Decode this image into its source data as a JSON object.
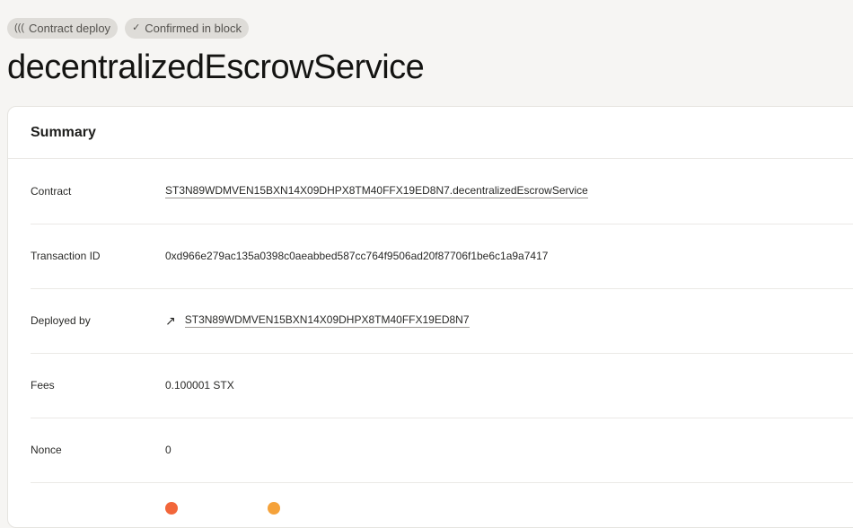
{
  "badges": [
    {
      "icon": "(((",
      "label": "Contract deploy"
    },
    {
      "icon": "✓",
      "label": "Confirmed in block"
    }
  ],
  "title": "decentralizedEscrowService",
  "summary": {
    "heading": "Summary",
    "rows": [
      {
        "label": "Contract",
        "value": "ST3N89WDMVEN15BXN14X09DHPX8TM40FFX19ED8N7.decentralizedEscrowService"
      },
      {
        "label": "Transaction ID",
        "value": "0xd966e279ac135a0398c0aeabbed587cc764f9506ad20f87706f1be6c1a9a7417"
      },
      {
        "label": "Deployed by",
        "value": "ST3N89WDMVEN15BXN14X09DHPX8TM40FFX19ED8N7"
      },
      {
        "label": "Fees",
        "value": "0.100001 STX"
      },
      {
        "label": "Nonce",
        "value": "0"
      }
    ]
  },
  "colors": {
    "dot1": "#f2663a",
    "dot2": "#f5a23a"
  }
}
